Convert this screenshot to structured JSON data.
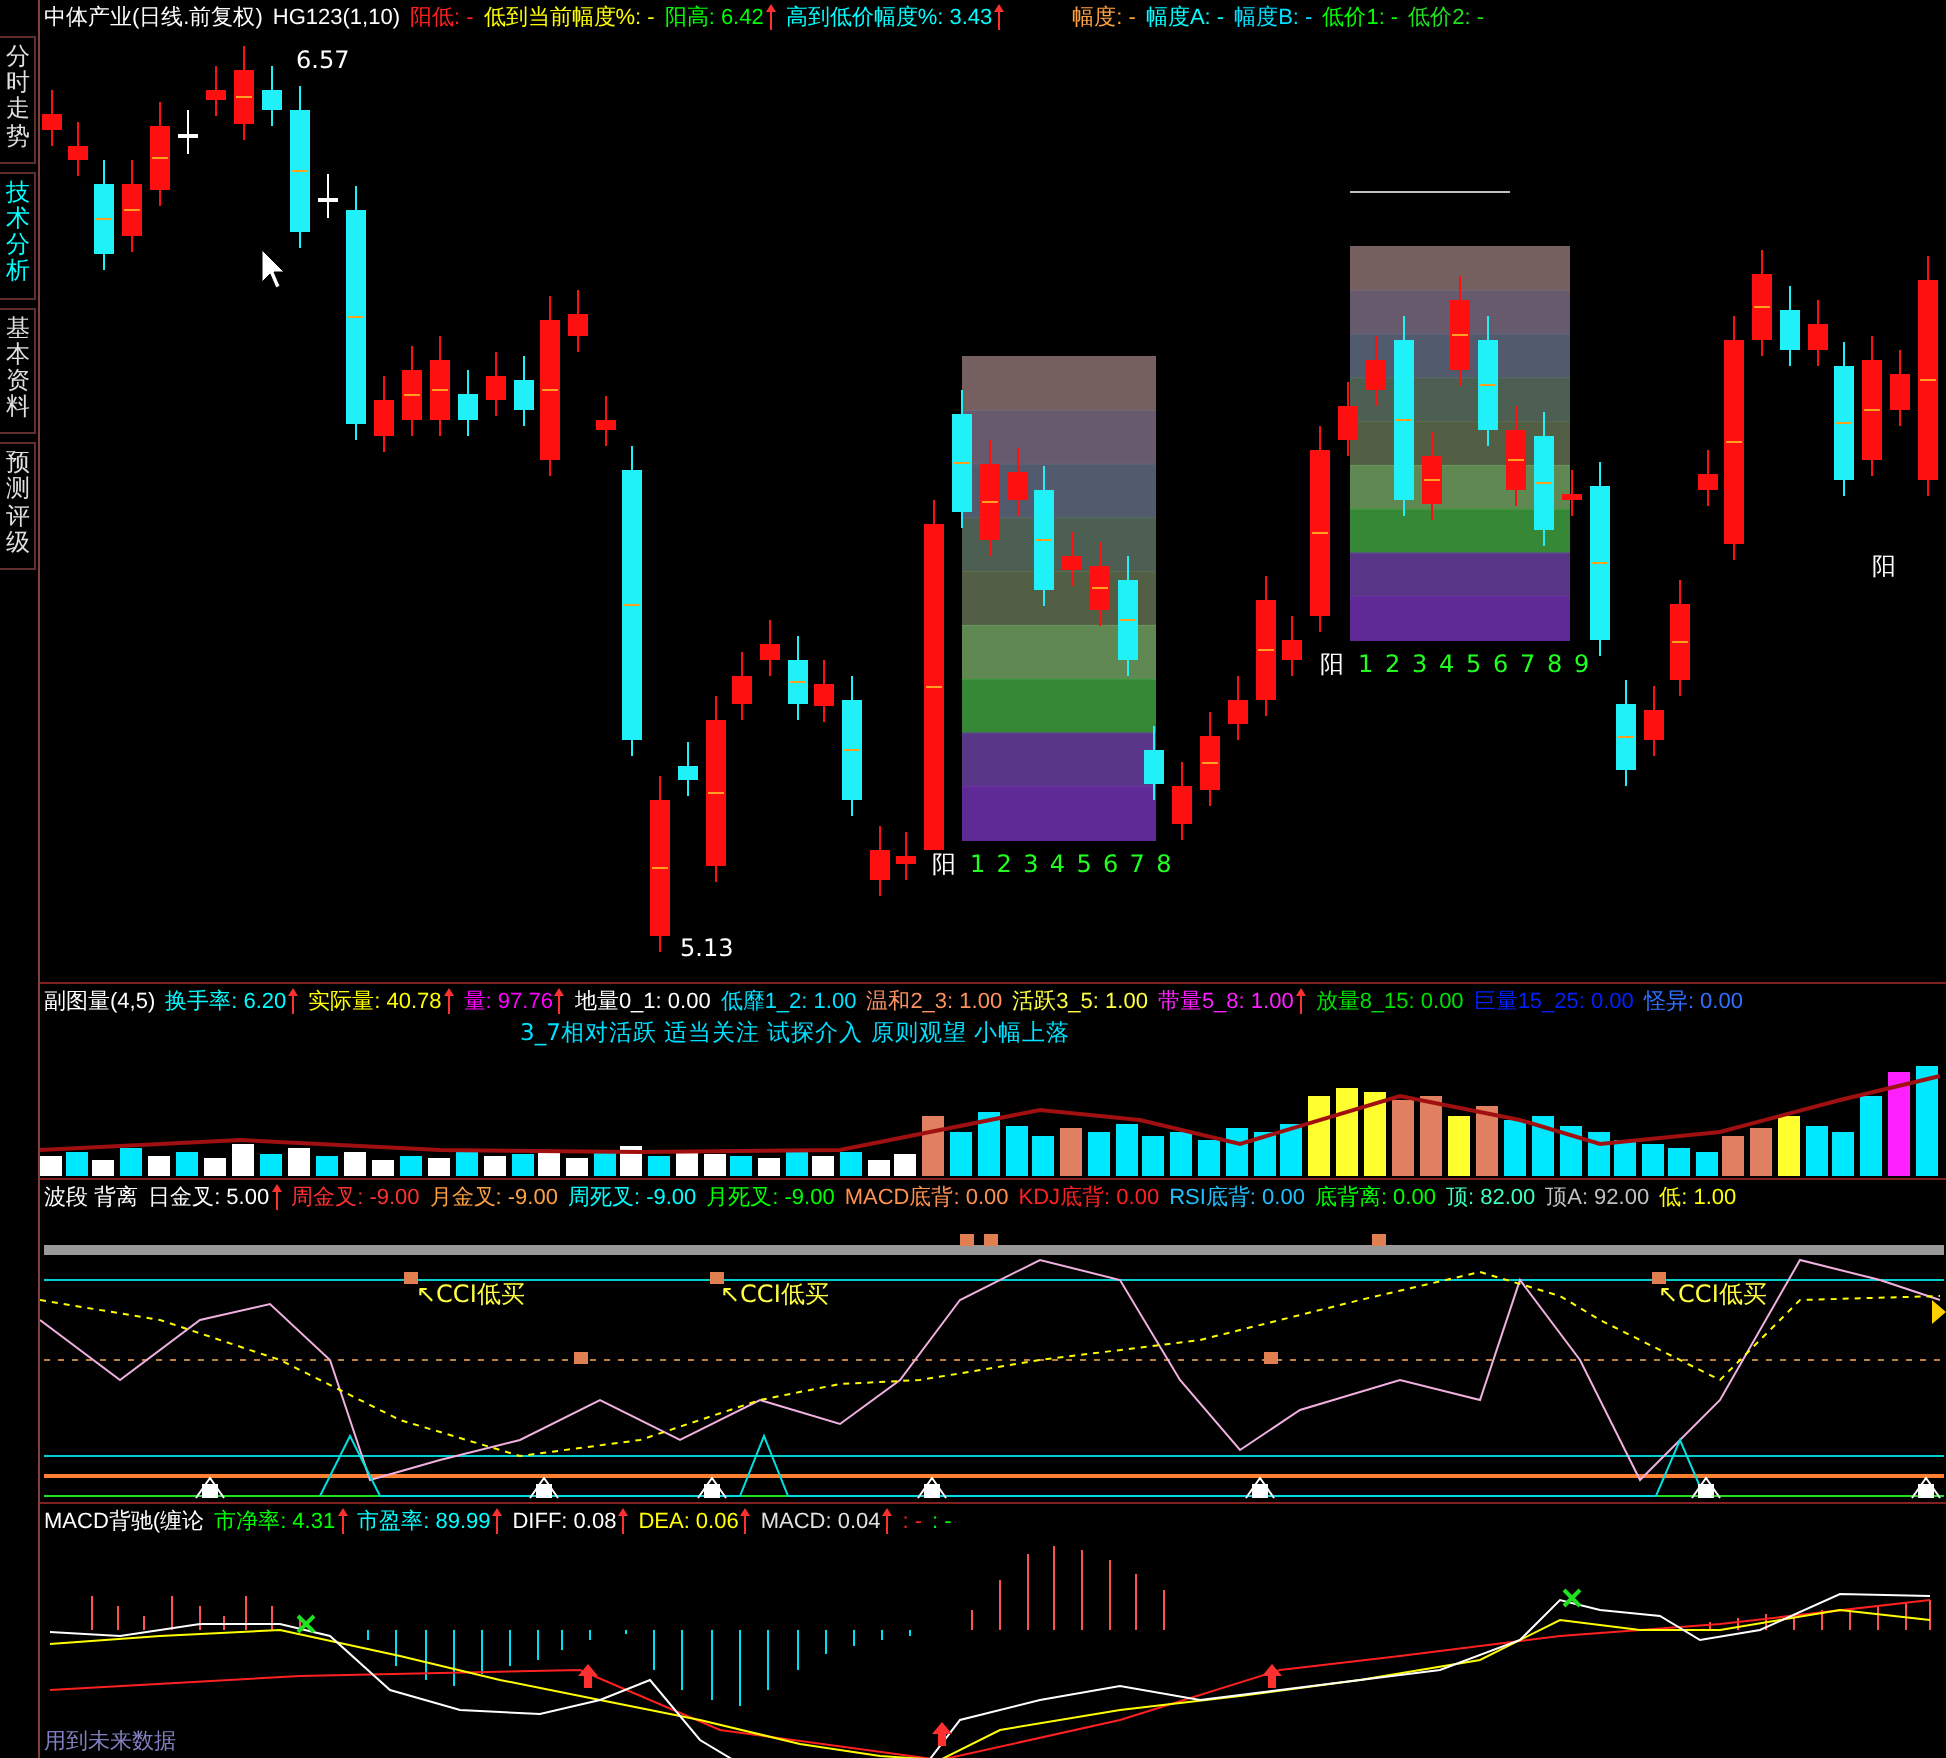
{
  "sidebar": {
    "tabs": [
      {
        "label": "分时走势",
        "selected": false
      },
      {
        "label": "技术分析",
        "selected": true
      },
      {
        "label": "基本资料",
        "selected": false
      },
      {
        "label": "预测评级",
        "selected": false
      }
    ]
  },
  "main_chart": {
    "title": "中体产业(日线.前复权)",
    "indicator": "HG123(1,10)",
    "readouts": [
      {
        "text": "阳低: -",
        "color": "#ff2020",
        "arrow": false
      },
      {
        "text": "低到当前幅度%: -",
        "color": "#ffff00",
        "arrow": false
      },
      {
        "text": "阳高: 6.42",
        "color": "#00ff00",
        "arrow": true
      },
      {
        "text": "高到低价幅度%: 3.43",
        "color": "#00ffff",
        "arrow": true
      }
    ],
    "readouts_2": [
      {
        "text": "幅度: -",
        "color": "#ffa040",
        "arrow": false
      },
      {
        "text": "幅度A: -",
        "color": "#00ffff",
        "arrow": false
      },
      {
        "text": "幅度B: -",
        "color": "#00e0ff",
        "arrow": false
      },
      {
        "text": "低价1: -",
        "color": "#00ff00",
        "arrow": false
      },
      {
        "text": "低价2: -",
        "color": "#20e020",
        "arrow": false
      }
    ],
    "high_label": "6.57",
    "low_label": "5.13",
    "markers": [
      {
        "text": "阳",
        "numbers": [
          "1",
          "2",
          "3",
          "4",
          "5",
          "6",
          "7",
          "8"
        ]
      },
      {
        "text": "阳",
        "numbers": [
          "1",
          "2",
          "3",
          "4",
          "5",
          "6",
          "7",
          "8",
          "9"
        ]
      },
      {
        "text": "阳"
      }
    ]
  },
  "volume_panel": {
    "title": "副图量(4,5)",
    "readouts": [
      {
        "text": "换手率: 6.20",
        "color": "#00ffff",
        "arrow": true
      },
      {
        "text": "实际量: 40.78",
        "color": "#ffff00",
        "arrow": true
      },
      {
        "text": "量: 97.76",
        "color": "#ff00ff",
        "arrow": true
      },
      {
        "text": "地量0_1: 0.00",
        "color": "#ffffff",
        "arrow": false
      },
      {
        "text": "低靡1_2: 1.00",
        "color": "#00e0ff",
        "arrow": false
      },
      {
        "text": "温和2_3: 1.00",
        "color": "#ff9060",
        "arrow": false
      },
      {
        "text": "活跃3_5: 1.00",
        "color": "#ffff40",
        "arrow": false
      },
      {
        "text": "带量5_8: 1.00",
        "color": "#ff20ff",
        "arrow": true
      },
      {
        "text": "放量8_15: 0.00",
        "color": "#00e000",
        "arrow": false
      },
      {
        "text": "巨量15_25: 0.00",
        "color": "#0020ff",
        "arrow": false
      },
      {
        "text": "怪异: 0.00",
        "color": "#3070ff",
        "arrow": false
      }
    ],
    "note": "3_7相对活跃 适当关注 试探介入 原则观望 小幅上落"
  },
  "signal_panel": {
    "title": "波段 背离",
    "readouts": [
      {
        "text": "日金叉: 5.00",
        "color": "#ffffff",
        "arrow": true
      },
      {
        "text": "周金叉: -9.00",
        "color": "#ff3030",
        "arrow": false
      },
      {
        "text": "月金叉: -9.00",
        "color": "#ffa040",
        "arrow": false
      },
      {
        "text": "周死叉: -9.00",
        "color": "#00ffff",
        "arrow": false
      },
      {
        "text": "月死叉: -9.00",
        "color": "#00ff00",
        "arrow": false
      },
      {
        "text": "MACD底背: 0.00",
        "color": "#ff9050",
        "arrow": false
      },
      {
        "text": "KDJ底背: 0.00",
        "color": "#ff2020",
        "arrow": false
      },
      {
        "text": "RSI底背: 0.00",
        "color": "#20c0ff",
        "arrow": false
      },
      {
        "text": "底背离: 0.00",
        "color": "#00ff00",
        "arrow": false
      },
      {
        "text": "顶: 82.00",
        "color": "#40ffc0",
        "arrow": false
      },
      {
        "text": "顶A: 92.00",
        "color": "#c0c0c0",
        "arrow": false
      },
      {
        "text": "低: 1.00",
        "color": "#ffff00",
        "arrow": false
      }
    ],
    "buy_labels": [
      "↖CCI低买",
      "↖CCI低买",
      "↖CCI低买"
    ]
  },
  "macd_panel": {
    "title": "MACD背驰(缠论",
    "readouts": [
      {
        "text": "市净率: 4.31",
        "color": "#00ff00",
        "arrow": true
      },
      {
        "text": "市盈率: 89.99",
        "color": "#00ffff",
        "arrow": true
      },
      {
        "text": "DIFF: 0.08",
        "color": "#ffffff",
        "arrow": true
      },
      {
        "text": "DEA: 0.06",
        "color": "#ffff00",
        "arrow": true
      },
      {
        "text": "MACD: 0.04",
        "color": "#e0e0e0",
        "arrow": true
      },
      {
        "text": ": -",
        "color": "#ff2020",
        "arrow": false
      },
      {
        "text": ": -",
        "color": "#00ff00",
        "arrow": false
      }
    ],
    "footer": "用到未来数据"
  }
}
